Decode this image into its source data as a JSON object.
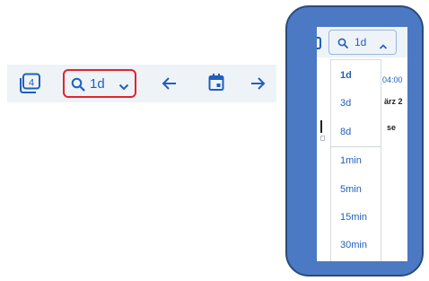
{
  "toolbar": {
    "count_badge": "4",
    "zoom_label": "1d"
  },
  "zoomed": {
    "zoom_label": "1d",
    "background_time": "04:00",
    "background_text_1": "ärz 2",
    "background_text_2": "se"
  },
  "zoom_menu": {
    "items": [
      "1d",
      "3d",
      "8d",
      "1min",
      "5min",
      "15min",
      "30min"
    ],
    "selected": "1d"
  },
  "colors": {
    "accent": "#1f5fbf",
    "highlight_border": "#e0252b",
    "callout_fill": "#4c79c4",
    "toolbar_bg": "#eef3f8"
  },
  "icons": {
    "count": "stack-badge-icon",
    "zoom": "search-icon",
    "expand": "chevron-down-icon",
    "collapse": "chevron-up-icon",
    "previous": "arrow-left-icon",
    "calendar": "calendar-icon",
    "next": "arrow-right-icon"
  }
}
